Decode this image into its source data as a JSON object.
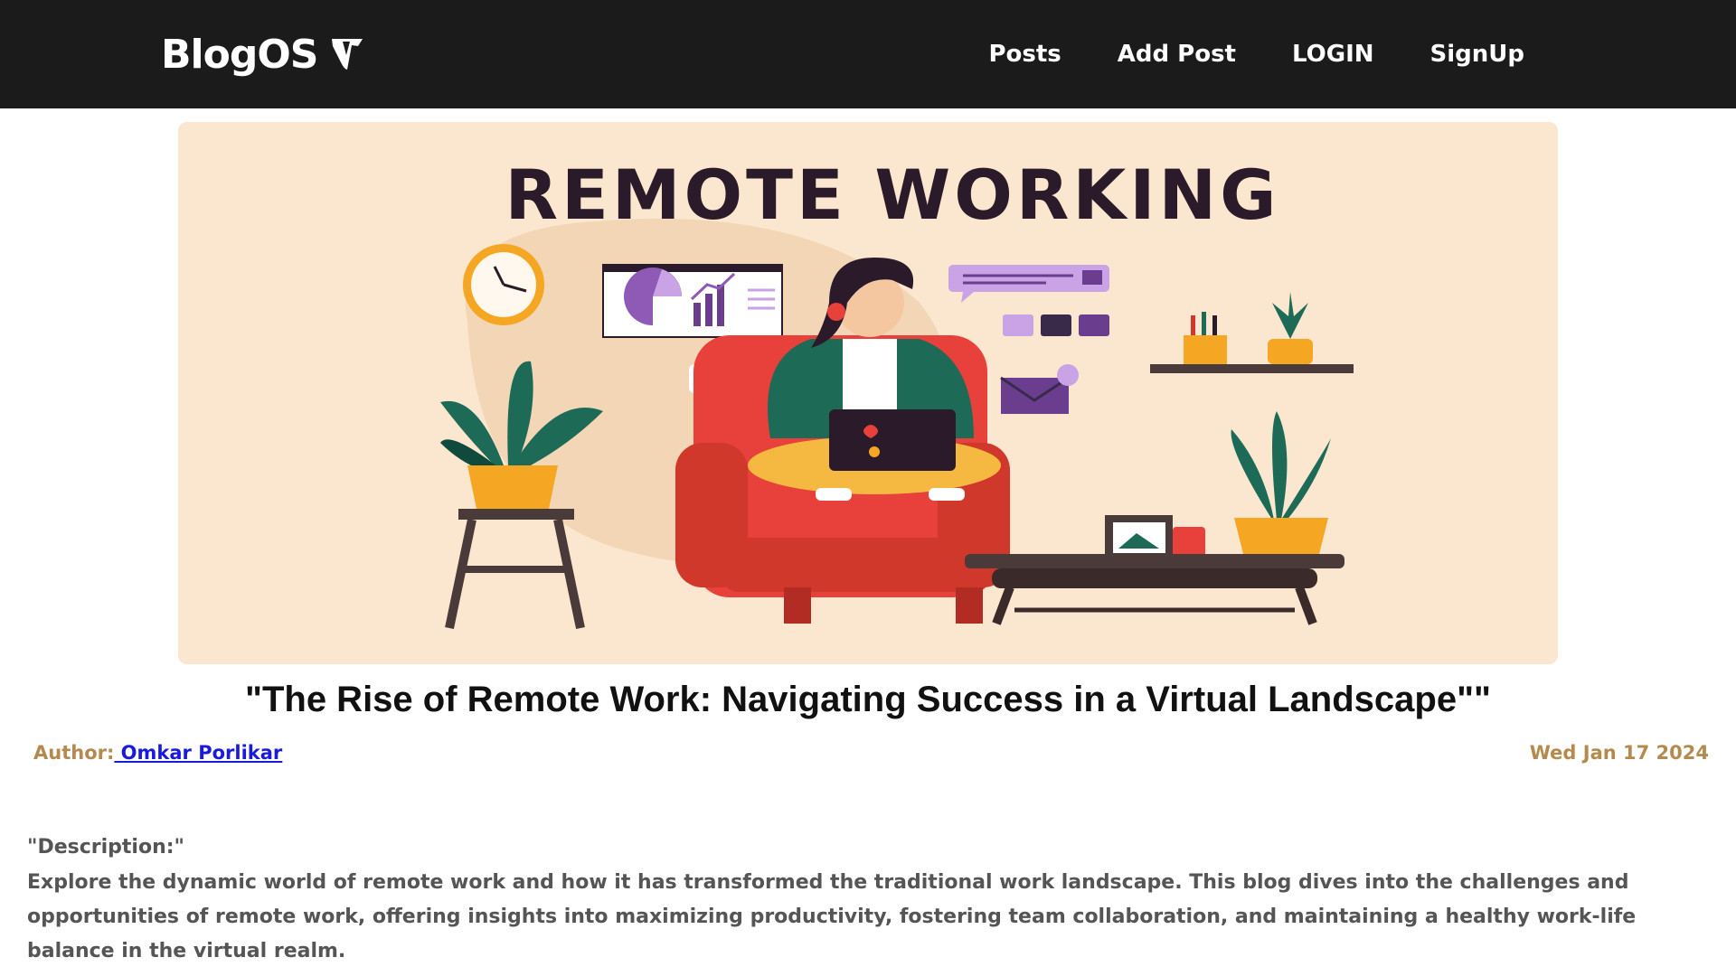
{
  "navbar": {
    "brand": "BlogOS",
    "brand_icon": "typo3-logo-icon",
    "links": [
      "Posts",
      "Add Post",
      "LOGIN",
      "SignUp"
    ]
  },
  "hero": {
    "heading": "REMOTE WORKING",
    "alt_icon": "remote-working-illustration"
  },
  "post": {
    "title": "\"The Rise of Remote Work: Navigating Success in a Virtual Landscape\"\"",
    "author_label": "Author:",
    "author_name": " Omkar Porlikar",
    "date": "Wed Jan 17 2024",
    "description_label": "\"Description:\"",
    "description": "Explore the dynamic world of remote work and how it has transformed the traditional work landscape. This blog dives into the challenges and opportunities of remote work, offering insights into maximizing productivity, fostering team collaboration, and maintaining a healthy work-life balance in the virtual realm."
  },
  "colors": {
    "navbar_bg": "#1c1b1b",
    "accent_gold": "#b48a4e",
    "link_blue": "#1a1adf",
    "hero_bg": "#fbe6cf"
  }
}
